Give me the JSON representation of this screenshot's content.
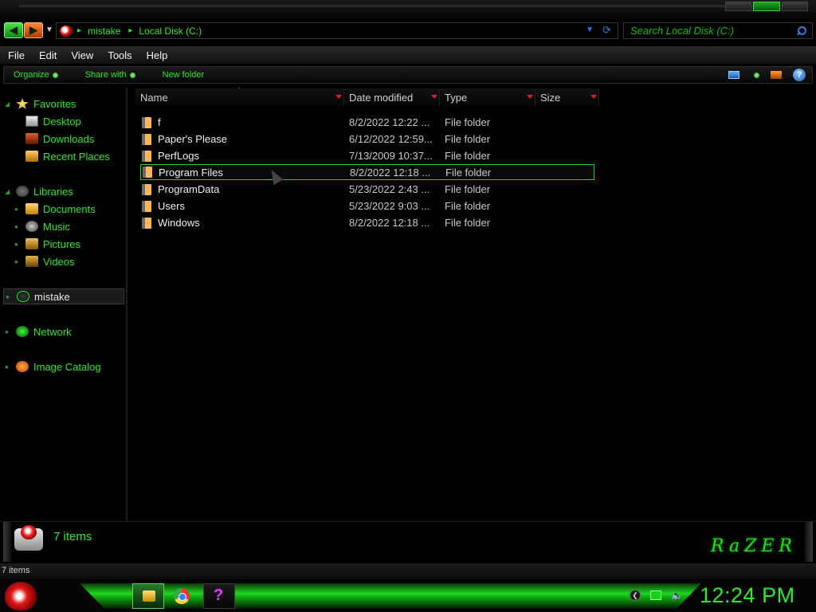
{
  "address": {
    "crumbs": [
      "mistake",
      "Local Disk (C:)"
    ],
    "search_placeholder": "Search Local Disk (C:)"
  },
  "menu": [
    "File",
    "Edit",
    "View",
    "Tools",
    "Help"
  ],
  "commands": {
    "organize": "Organize",
    "share_with": "Share with",
    "new_folder": "New folder"
  },
  "nav": {
    "favorites": "Favorites",
    "desktop": "Desktop",
    "downloads": "Downloads",
    "recent_places": "Recent Places",
    "libraries": "Libraries",
    "documents": "Documents",
    "music": "Music",
    "pictures": "Pictures",
    "videos": "Videos",
    "user": "mistake",
    "network": "Network",
    "image_catalog": "Image Catalog"
  },
  "columns": [
    "Name",
    "Date modified",
    "Type",
    "Size"
  ],
  "files": [
    {
      "name": "f",
      "date": "8/2/2022 12:22 ...",
      "type": "File folder"
    },
    {
      "name": "Paper's Please",
      "date": "6/12/2022 12:59...",
      "type": "File folder"
    },
    {
      "name": "PerfLogs",
      "date": "7/13/2009 10:37...",
      "type": "File folder"
    },
    {
      "name": "Program Files",
      "date": "8/2/2022 12:18 ...",
      "type": "File folder"
    },
    {
      "name": "ProgramData",
      "date": "5/23/2022 2:43 ...",
      "type": "File folder"
    },
    {
      "name": "Users",
      "date": "5/23/2022 9:03 ...",
      "type": "File folder"
    },
    {
      "name": "Windows",
      "date": "8/2/2022 12:18 ...",
      "type": "File folder"
    }
  ],
  "selected_file": "Program Files",
  "details": {
    "count": "7 items",
    "brand": "RaZER"
  },
  "status": {
    "items": "7 items"
  },
  "clock": "12:24 PM",
  "colors": {
    "accent": "#2ee82e",
    "selection_border": "#2ad02a",
    "sort_arrow": "#e02020"
  }
}
